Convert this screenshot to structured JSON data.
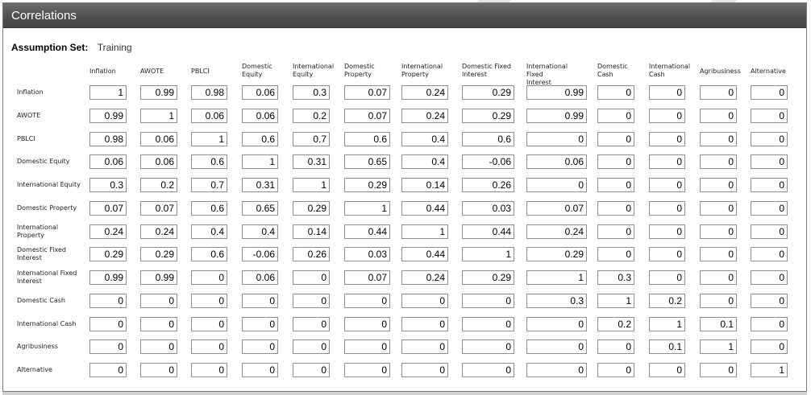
{
  "panel": {
    "title": "Correlations"
  },
  "assumption_set": {
    "label": "Assumption Set:",
    "value": "Training"
  },
  "columns": [
    [
      "Inflation"
    ],
    [
      "AWOTE"
    ],
    [
      "PBLCI"
    ],
    [
      "Domestic",
      "Equity"
    ],
    [
      "International",
      "Equity"
    ],
    [
      "Domestic",
      "Property"
    ],
    [
      "International",
      "Property"
    ],
    [
      "Domestic Fixed",
      "Interest"
    ],
    [
      "International Fixed",
      "Interest"
    ],
    [
      "Domestic",
      "Cash"
    ],
    [
      "International",
      "Cash"
    ],
    [
      "Agribusiness"
    ],
    [
      "Alternative"
    ]
  ],
  "rows": [
    {
      "label": [
        "Inflation"
      ],
      "values": [
        "1",
        "0.99",
        "0.98",
        "0.06",
        "0.3",
        "0.07",
        "0.24",
        "0.29",
        "0.99",
        "0",
        "0",
        "0",
        "0"
      ]
    },
    {
      "label": [
        "AWOTE"
      ],
      "values": [
        "0.99",
        "1",
        "0.06",
        "0.06",
        "0.2",
        "0.07",
        "0.24",
        "0.29",
        "0.99",
        "0",
        "0",
        "0",
        "0"
      ]
    },
    {
      "label": [
        "PBLCI"
      ],
      "values": [
        "0.98",
        "0.06",
        "1",
        "0.6",
        "0.7",
        "0.6",
        "0.4",
        "0.6",
        "0",
        "0",
        "0",
        "0",
        "0"
      ]
    },
    {
      "label": [
        "Domestic Equity"
      ],
      "values": [
        "0.06",
        "0.06",
        "0.6",
        "1",
        "0.31",
        "0.65",
        "0.4",
        "-0.06",
        "0.06",
        "0",
        "0",
        "0",
        "0"
      ]
    },
    {
      "label": [
        "International Equity"
      ],
      "values": [
        "0.3",
        "0.2",
        "0.7",
        "0.31",
        "1",
        "0.29",
        "0.14",
        "0.26",
        "0",
        "0",
        "0",
        "0",
        "0"
      ]
    },
    {
      "label": [
        "Domestic Property"
      ],
      "values": [
        "0.07",
        "0.07",
        "0.6",
        "0.65",
        "0.29",
        "1",
        "0.44",
        "0.03",
        "0.07",
        "0",
        "0",
        "0",
        "0"
      ]
    },
    {
      "label": [
        "International",
        "Property"
      ],
      "values": [
        "0.24",
        "0.24",
        "0.4",
        "0.4",
        "0.14",
        "0.44",
        "1",
        "0.44",
        "0.24",
        "0",
        "0",
        "0",
        "0"
      ]
    },
    {
      "label": [
        "Domestic Fixed",
        "Interest"
      ],
      "values": [
        "0.29",
        "0.29",
        "0.6",
        "-0.06",
        "0.26",
        "0.03",
        "0.44",
        "1",
        "0.29",
        "0",
        "0",
        "0",
        "0"
      ]
    },
    {
      "label": [
        "International Fixed",
        "Interest"
      ],
      "values": [
        "0.99",
        "0.99",
        "0",
        "0.06",
        "0",
        "0.07",
        "0.24",
        "0.29",
        "1",
        "0.3",
        "0",
        "0",
        "0"
      ]
    },
    {
      "label": [
        "Domestic Cash"
      ],
      "values": [
        "0",
        "0",
        "0",
        "0",
        "0",
        "0",
        "0",
        "0",
        "0.3",
        "1",
        "0.2",
        "0",
        "0"
      ]
    },
    {
      "label": [
        "International Cash"
      ],
      "values": [
        "0",
        "0",
        "0",
        "0",
        "0",
        "0",
        "0",
        "0",
        "0",
        "0.2",
        "1",
        "0.1",
        "0"
      ]
    },
    {
      "label": [
        "Agribusiness"
      ],
      "values": [
        "0",
        "0",
        "0",
        "0",
        "0",
        "0",
        "0",
        "0",
        "0",
        "0",
        "0.1",
        "1",
        "0"
      ]
    },
    {
      "label": [
        "Alternative"
      ],
      "values": [
        "0",
        "0",
        "0",
        "0",
        "0",
        "0",
        "0",
        "0",
        "0",
        "0",
        "0",
        "0",
        "1"
      ]
    }
  ]
}
